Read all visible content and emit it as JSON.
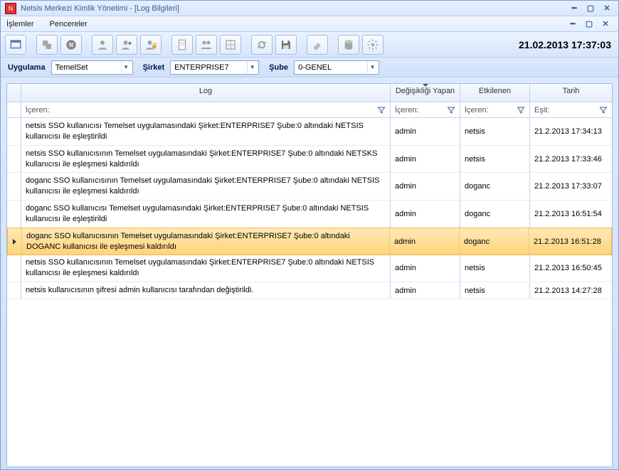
{
  "window": {
    "title": "Netsis Merkezi Kimlik Yönetimi - [Log Bilgileri]"
  },
  "menu": {
    "islemler": "İşlemler",
    "pencereler": "Pencereler"
  },
  "clock": "21.02.2013 17:37:03",
  "filters": {
    "uygulama_label": "Uygulama",
    "uygulama_value": "TemelSet",
    "sirket_label": "Şirket",
    "sirket_value": "ENTERPRISE7",
    "sube_label": "Şube",
    "sube_value": "0-GENEL"
  },
  "grid": {
    "headers": {
      "log": "Log",
      "changed_by": "Değişikliği Yapan",
      "affected": "Etkilenen",
      "date": "Tarih"
    },
    "filter_row": {
      "contains": "İçeren:",
      "equals": "Eşit:"
    },
    "rows": [
      {
        "log": "netsis SSO kullanıcısı Temelset uygulamasındaki Şirket:ENTERPRISE7 Şube:0 altındaki NETSIS kullanıcısı ile eşleştirildi",
        "by": "admin",
        "aff": "netsis",
        "date": "21.2.2013 17:34:13",
        "selected": false
      },
      {
        "log": "netsis SSO kullanıcısının Temelset uygulamasındaki Şirket:ENTERPRISE7 Şube:0 altındaki NETSKS kullanıcısı ile eşleşmesi kaldırıldı",
        "by": "admin",
        "aff": "netsis",
        "date": "21.2.2013 17:33:46",
        "selected": false
      },
      {
        "log": "doganc SSO kullanıcısının Temelset uygulamasındaki Şirket:ENTERPRISE7 Şube:0 altındaki NETSIS kullanıcısı ile eşleşmesi kaldırıldı",
        "by": "admin",
        "aff": "doganc",
        "date": "21.2.2013 17:33:07",
        "selected": false
      },
      {
        "log": "doganc SSO kullanıcısı Temelset uygulamasındaki Şirket:ENTERPRISE7 Şube:0 altındaki NETSIS kullanıcısı ile eşleştirildi",
        "by": "admin",
        "aff": "doganc",
        "date": "21.2.2013 16:51:54",
        "selected": false
      },
      {
        "log": "doganc SSO kullanıcısının Temelset uygulamasındaki Şirket:ENTERPRISE7 Şube:0 altındaki DOGANC kullanıcısı ile eşleşmesi kaldırıldı",
        "by": "admin",
        "aff": "doganc",
        "date": "21.2.2013 16:51:28",
        "selected": true
      },
      {
        "log": "netsis SSO kullanıcısının Temelset uygulamasındaki Şirket:ENTERPRISE7 Şube:0 altındaki NETSIS kullanıcısı ile eşleşmesi kaldırıldı",
        "by": "admin",
        "aff": "netsis",
        "date": "21.2.2013 16:50:45",
        "selected": false
      },
      {
        "log": "netsis kullanıcısının şifresi admin kullanıcısı tarafından değiştirildi.",
        "by": "admin",
        "aff": "netsis",
        "date": "21.2.2013 14:27:28",
        "selected": false
      }
    ]
  }
}
